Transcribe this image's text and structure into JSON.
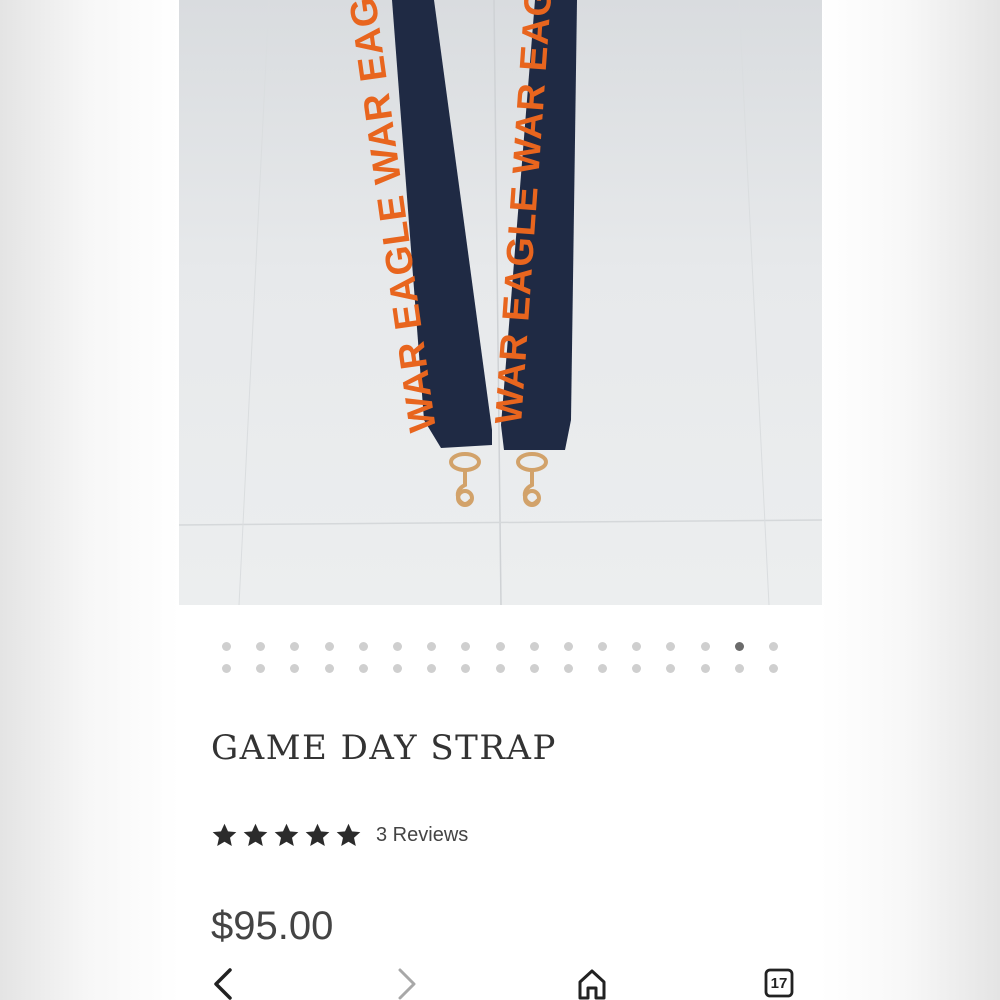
{
  "product": {
    "image_alt": "Navy beaded strap with orange WAR EAGLE lettering",
    "strap_text_left": "WAR EAGLE WAR EAGLE",
    "strap_text_right": "WAR EAGLE WAR EAGLE",
    "title": "GAME DAY STRAP",
    "rating": {
      "stars": 5,
      "max": 5,
      "reviews_label": "3 Reviews"
    },
    "price": "$95.00"
  },
  "carousel": {
    "rows": [
      {
        "count": 17,
        "active_index": 15
      },
      {
        "count": 17,
        "active_index": -1
      }
    ]
  },
  "toolbar": {
    "back_icon": "chevron-left-icon",
    "forward_icon": "chevron-right-icon",
    "home_icon": "home-icon",
    "tabs_icon": "tabs-icon",
    "tabs_count": "17"
  },
  "colors": {
    "strap_navy": "#1f2a44",
    "strap_orange": "#e8651e",
    "text": "#333333",
    "active_dot": "#6b6b6b",
    "inactive_dot": "#cfcfcf"
  }
}
